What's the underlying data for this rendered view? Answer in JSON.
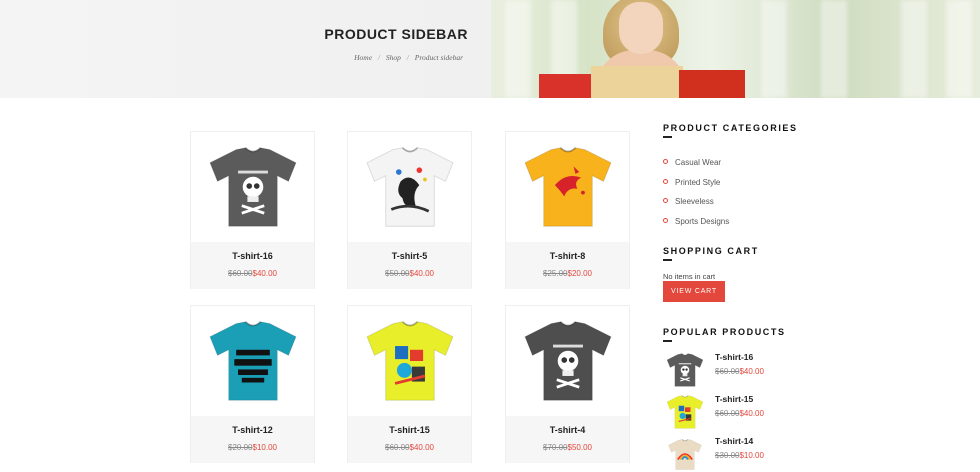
{
  "banner": {
    "title": "PRODUCT SIDEBAR",
    "breadcrumb": {
      "home": "Home",
      "shop": "Shop",
      "current": "Product sidebar",
      "separator": "/"
    }
  },
  "products": [
    {
      "name": "T-shirt-16",
      "old_price": "$60.00",
      "price": "$40.00",
      "shirt_color": "#5b5b5b",
      "graphic": "skull"
    },
    {
      "name": "T-shirt-5",
      "old_price": "$50.00",
      "price": "$40.00",
      "shirt_color": "#f4f4f4",
      "graphic": "splash"
    },
    {
      "name": "T-shirt-8",
      "old_price": "$25.00",
      "price": "$20.00",
      "shirt_color": "#f7b21c",
      "graphic": "bird"
    },
    {
      "name": "T-shirt-12",
      "old_price": "$20.00",
      "price": "$10.00",
      "shirt_color": "#1b9fb7",
      "graphic": "lettering"
    },
    {
      "name": "T-shirt-15",
      "old_price": "$60.00",
      "price": "$40.00",
      "shirt_color": "#e8ee2a",
      "graphic": "collage"
    },
    {
      "name": "T-shirt-4",
      "old_price": "$70.00",
      "price": "$50.00",
      "shirt_color": "#4e4e4e",
      "graphic": "skull"
    }
  ],
  "sidebar": {
    "categories_title": "PRODUCT CATEGORIES",
    "categories": [
      "Casual Wear",
      "Printed Style",
      "Sleeveless",
      "Sports Designs"
    ],
    "cart_title": "SHOPPING CART",
    "cart_empty": "No items in cart",
    "view_cart_label": "VIEW CART",
    "popular_title": "POPULAR PRODUCTS",
    "popular": [
      {
        "name": "T-shirt-16",
        "old_price": "$60.00",
        "price": "$40.00",
        "shirt_color": "#5b5b5b",
        "graphic": "skull"
      },
      {
        "name": "T-shirt-15",
        "old_price": "$60.00",
        "price": "$40.00",
        "shirt_color": "#e8ee2a",
        "graphic": "collage"
      },
      {
        "name": "T-shirt-14",
        "old_price": "$30.00",
        "price": "$10.00",
        "shirt_color": "#eadcc4",
        "graphic": "rainbow"
      }
    ]
  },
  "colors": {
    "accent": "#e4473c",
    "card_info_bg": "#f6f6f6"
  }
}
